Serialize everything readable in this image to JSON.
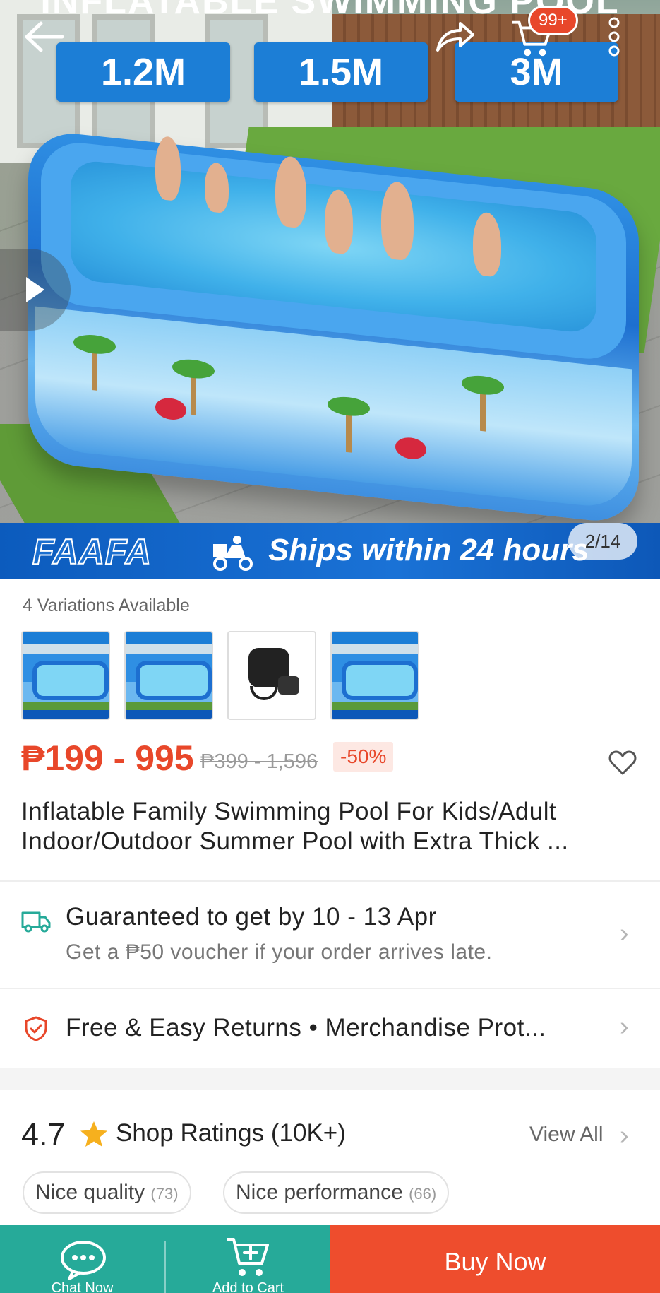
{
  "hero": {
    "top_title": "INFLATABLE SWIMMING POOL",
    "sizes": [
      "1.2M",
      "1.5M",
      "3M"
    ],
    "brand_logo": "FAAFA",
    "ships_text": "Ships within 24 hours",
    "image_counter": "2/14",
    "cart_badge": "99+"
  },
  "variations": {
    "label": "4 Variations Available",
    "thumbnails": [
      "pool",
      "pool",
      "air-pump",
      "pool"
    ]
  },
  "price": {
    "range": "₱199 - 995",
    "original": "₱399 - 1,596",
    "discount": "-50%"
  },
  "product": {
    "title": "Inflatable Family Swimming Pool For Kids/Adult Indoor/Outdoor Summer Pool with Extra Thick ..."
  },
  "delivery": {
    "main": "Guaranteed to get by 10 - 13 Apr",
    "sub": "Get a ₱50 voucher if your order arrives late."
  },
  "returns": {
    "text": "Free & Easy Returns  •  Merchandise Prot..."
  },
  "ratings": {
    "score": "4.7",
    "label": "Shop Ratings (10K+)",
    "view_all": "View All",
    "chips": [
      {
        "label": "Nice quality",
        "count": "(73)"
      },
      {
        "label": "Nice performance",
        "count": "(66)"
      }
    ]
  },
  "bottom_bar": {
    "chat_label": "Chat Now",
    "cart_label": "Add to Cart",
    "buy_now": "Buy Now"
  },
  "colors": {
    "accent": "#ee4d2d",
    "teal": "#26aa99",
    "price": "#e8472a"
  }
}
